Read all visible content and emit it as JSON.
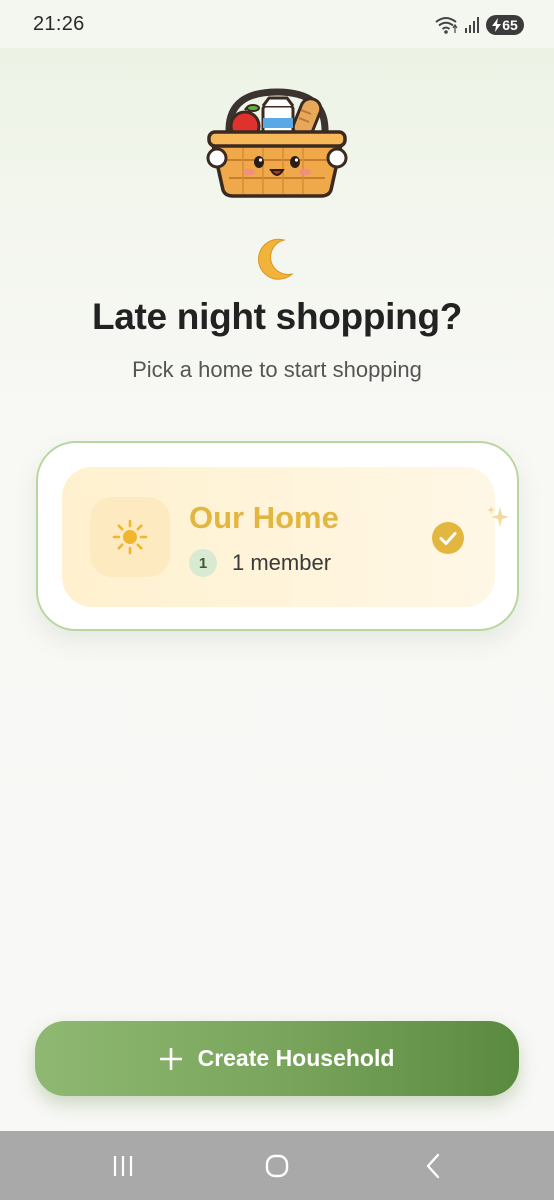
{
  "status_bar": {
    "time": "21:26",
    "battery_level": "65",
    "icons": [
      "wifi-icon",
      "signal-icon",
      "battery-charging-icon"
    ]
  },
  "mascot": {
    "icon": "grocery-basket-mascot"
  },
  "greeting": {
    "icon": "crescent-moon-icon",
    "title": "Late night shopping?",
    "subtitle": "Pick a home to start shopping"
  },
  "households": [
    {
      "name": "Our Home",
      "icon": "sun-icon",
      "member_count": "1",
      "member_label": "1 member",
      "selected": true
    }
  ],
  "actions": {
    "create_household_label": "Create Household"
  },
  "nav": {
    "buttons": [
      "recent-apps",
      "home",
      "back"
    ]
  },
  "colors": {
    "accent_green": "#77a35a",
    "home_name_gold": "#e2b63f",
    "card_border": "#b8d6a0"
  }
}
